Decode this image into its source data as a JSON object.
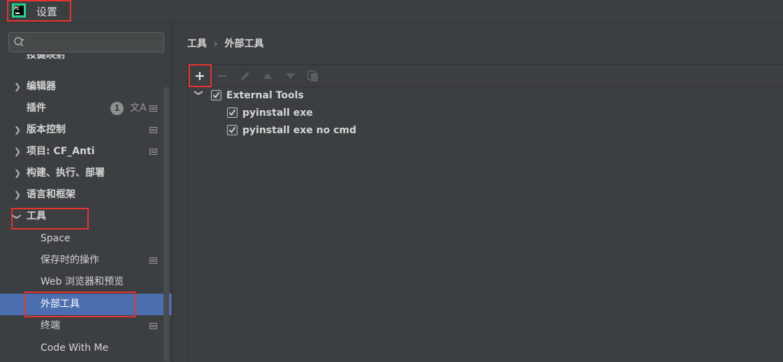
{
  "window": {
    "title": "设置"
  },
  "sidebar": {
    "search": {
      "placeholder": ""
    },
    "items": [
      {
        "label": "按键映射"
      },
      {
        "label": "编辑器"
      },
      {
        "label": "插件",
        "badge": "1"
      },
      {
        "label": "版本控制"
      },
      {
        "label": "项目: CF_Anti"
      },
      {
        "label": "构建、执行、部署"
      },
      {
        "label": "语言和框架"
      },
      {
        "label": "工具"
      },
      {
        "label": "Space"
      },
      {
        "label": "保存时的操作"
      },
      {
        "label": "Web 浏览器和预览"
      },
      {
        "label": "外部工具"
      },
      {
        "label": "终端"
      },
      {
        "label": "Code With Me"
      }
    ],
    "selected": "外部工具"
  },
  "breadcrumb": {
    "parent": "工具",
    "separator": "›",
    "current": "外部工具"
  },
  "toolbar": {
    "icons": [
      "add-icon",
      "remove-icon",
      "edit-icon",
      "move-up-icon",
      "move-down-icon",
      "copy-icon"
    ]
  },
  "tree": {
    "group": {
      "label": "External Tools",
      "checked": true,
      "expanded": true
    },
    "children": [
      {
        "label": "pyinstall exe",
        "checked": true
      },
      {
        "label": "pyinstall exe no cmd",
        "checked": true
      }
    ]
  },
  "colors": {
    "highlight_box": "#e8322e",
    "selection": "#4b6eaf",
    "background": "#3c3f41"
  }
}
